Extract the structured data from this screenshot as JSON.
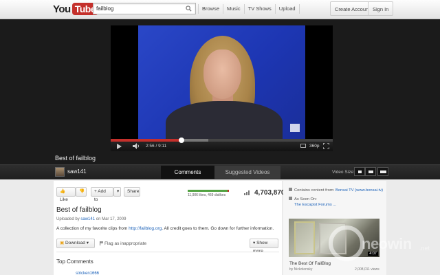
{
  "masthead": {
    "logo_you": "You",
    "logo_tube": "Tube",
    "search_value": "failblog",
    "nav": [
      "Browse",
      "Music",
      "TV Shows",
      "Upload"
    ],
    "create_account": "Create Account",
    "sign_in": "Sign In"
  },
  "player": {
    "time": "2:56 / 9:11",
    "quality": "360p",
    "progress_fraction": 0.32,
    "loaded_fraction": 0.44
  },
  "video": {
    "title": "Best of failblog"
  },
  "channel_bar": {
    "channel": "saw141",
    "tabs": [
      "Comments",
      "Suggested Videos"
    ],
    "video_size_label": "Video Size:"
  },
  "actions": {
    "like": "Like",
    "add_to": "+ Add to",
    "share": "Share",
    "likes_summary": "11,906 likes, 469 dislikes",
    "like_fraction": 0.962,
    "views": "4,703,870",
    "download": "Download",
    "flag": "Flag as inappropriate",
    "show_more": "Show more"
  },
  "details": {
    "title": "Best of failblog",
    "uploaded_by_prefix": "Uploaded by",
    "uploader": "saw141",
    "uploaded_on": "on Mar 17, 2009",
    "desc_before": "A collection of my favorite clips from ",
    "desc_link": "http://failblog.org",
    "desc_after": ". All credit goes to them. Go down for further information."
  },
  "comments": {
    "heading": "Top Comments",
    "first_user": "stricken1666"
  },
  "sidebar": {
    "contains_prefix": "Contains content from:",
    "contains_link": "Bonsai TV (www.bonsai.tv)",
    "seen_label": "As Seen On:",
    "seen_link": "The Escapist Forums ...",
    "video_title": "The Best Of FailBlog",
    "video_by": "by Nickolensky",
    "video_views": "2,008,011 views",
    "video_duration": "4:07"
  },
  "watermark": {
    "text": "neowin",
    "suffix": ".net"
  },
  "colors": {
    "brand_red": "#c4302b",
    "link": "#1c62b9",
    "like_green": "#51a240"
  }
}
